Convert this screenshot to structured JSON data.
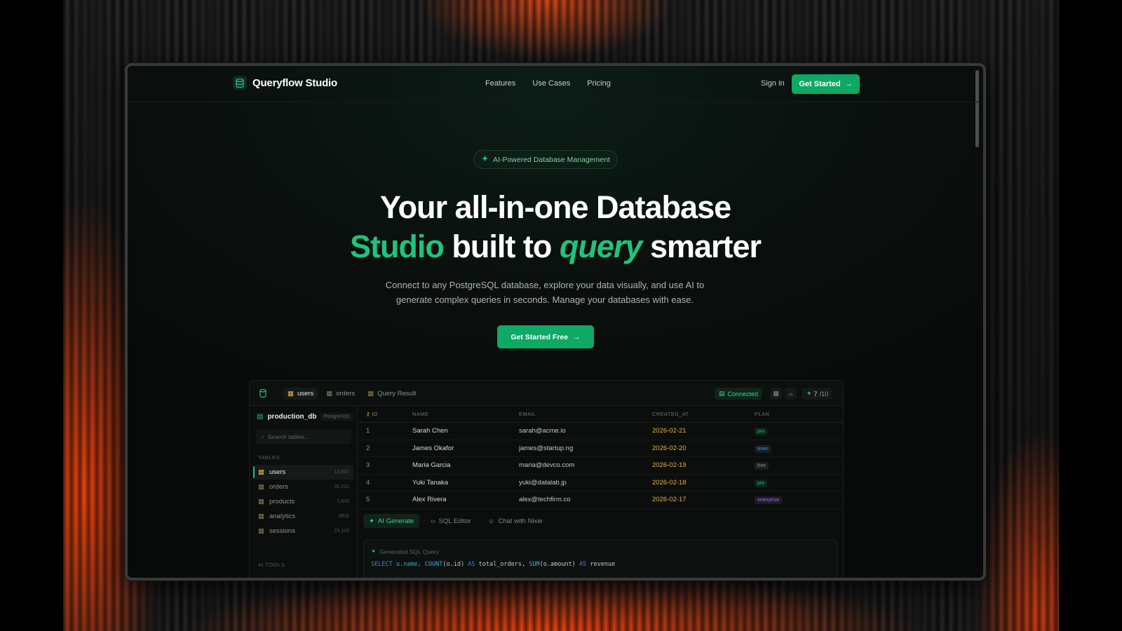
{
  "nav": {
    "brand": "Queryflow Studio",
    "links": [
      "Features",
      "Use Cases",
      "Pricing"
    ],
    "signin": "Sign in",
    "cta": "Get Started"
  },
  "hero": {
    "badge": "AI-Powered Database Management",
    "headline_line1": "Your all-in-one Database",
    "headline_green": "Studio",
    "headline_mid": "built to",
    "headline_italic": "query",
    "headline_end": "smarter",
    "subtitle": "Connect to any PostgreSQL database, explore your data visually, and use AI to generate complex queries in seconds. Manage your databases with ease.",
    "cta": "Get Started Free"
  },
  "app": {
    "tabs": [
      "users",
      "orders",
      "Query Result"
    ],
    "status": "Connected",
    "ai_count": "7",
    "ai_total": "/10",
    "sidebar": {
      "db_name": "production_db",
      "db_type": "PostgreSQL",
      "search_placeholder": "Search tables...",
      "tables_label": "TABLES",
      "ai_tools_label": "AI TOOLS",
      "tables": [
        {
          "name": "users",
          "count": "12,847"
        },
        {
          "name": "orders",
          "count": "45,231"
        },
        {
          "name": "products",
          "count": "1,893"
        },
        {
          "name": "analytics",
          "count": "892k"
        },
        {
          "name": "sessions",
          "count": "23,102"
        }
      ]
    },
    "columns": [
      "ID",
      "NAME",
      "EMAIL",
      "CREATED_AT",
      "PLAN"
    ],
    "rows": [
      {
        "id": "1",
        "name": "Sarah Chen",
        "email": "sarah@acme.io",
        "created_at": "2026-02-21",
        "plan": "pro"
      },
      {
        "id": "2",
        "name": "James Okafor",
        "email": "james@startup.ng",
        "created_at": "2026-02-20",
        "plan": "team"
      },
      {
        "id": "3",
        "name": "Maria Garcia",
        "email": "maria@devco.com",
        "created_at": "2026-02-19",
        "plan": "free"
      },
      {
        "id": "4",
        "name": "Yuki Tanaka",
        "email": "yuki@datalab.jp",
        "created_at": "2026-02-18",
        "plan": "pro"
      },
      {
        "id": "5",
        "name": "Alex Rivera",
        "email": "alex@techfirm.co",
        "created_at": "2026-02-17",
        "plan": "enterprise"
      }
    ],
    "plan_colors": {
      "pro": "#1fc47c",
      "team": "#4c8fe0",
      "free": "#8a928d",
      "enterprise": "#a86ad8"
    },
    "bottom_tabs": [
      "AI Generate",
      "SQL Editor",
      "Chat with Nixie"
    ],
    "sql_title": "Generated SQL Query",
    "sql_line": {
      "select": "SELECT",
      "col1": "u.name,",
      "count": "COUNT",
      "arg1": "(o.id)",
      "as1": "AS",
      "alias1": "total_orders,",
      "sum": "SUM",
      "arg2": "(o.amount)",
      "as2": "AS",
      "alias2": "revenue"
    }
  },
  "colors": {
    "accent": "#0fa864",
    "accent_text": "#1fc47c",
    "date": "#e9b044"
  }
}
